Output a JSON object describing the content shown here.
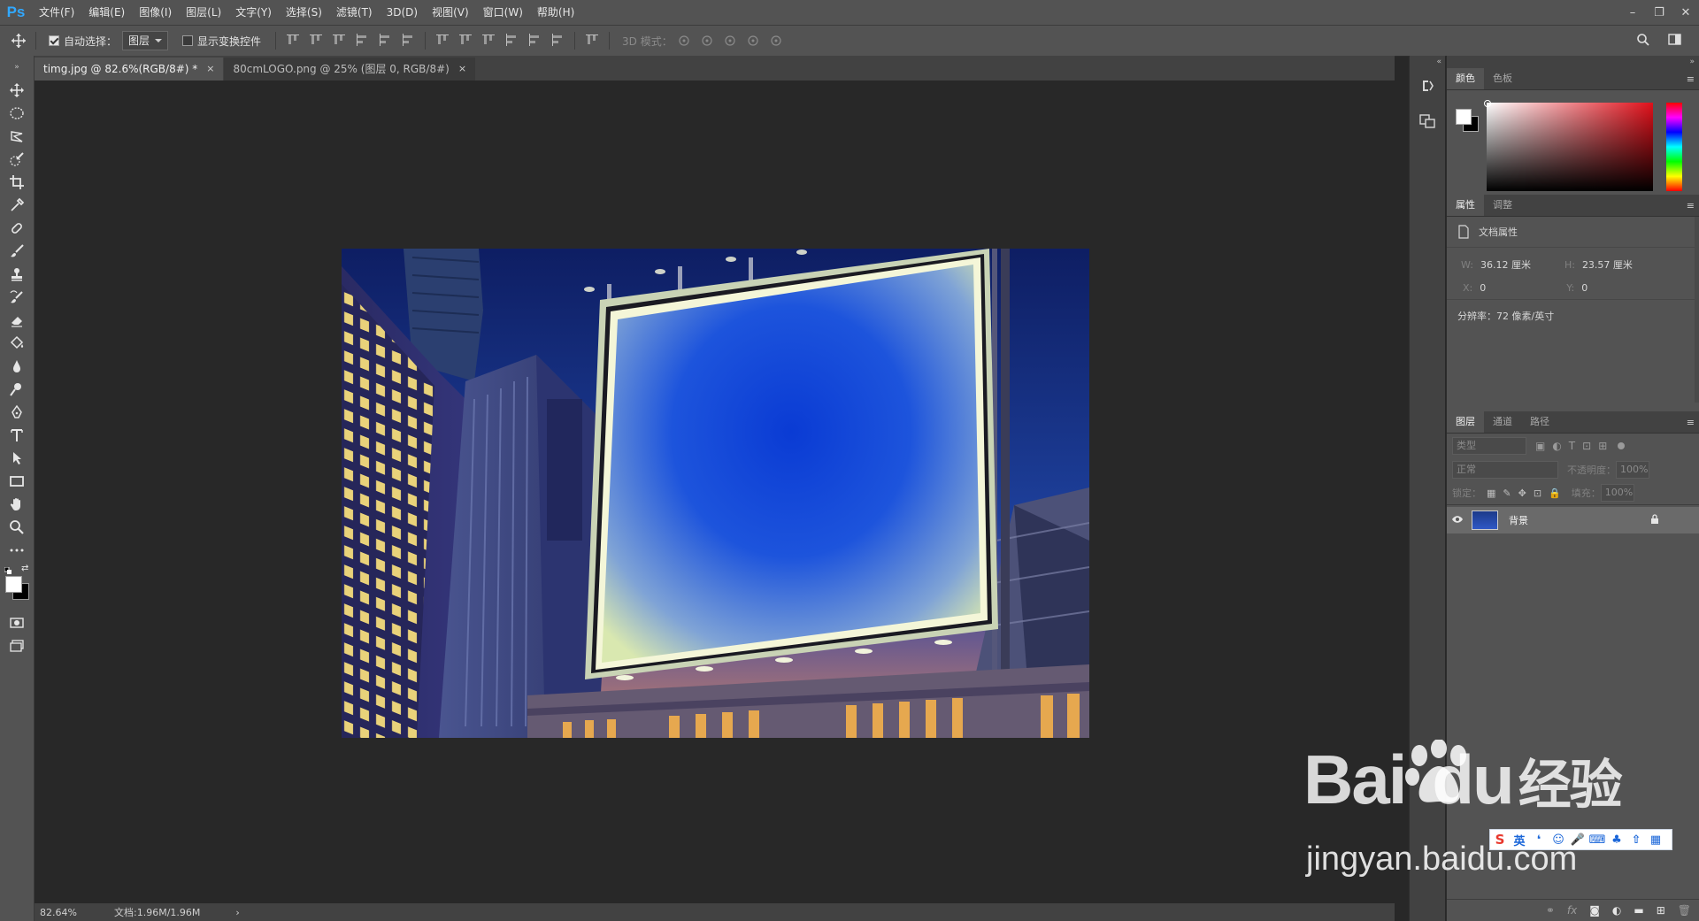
{
  "app": {
    "logo": "Ps"
  },
  "menu": [
    "文件(F)",
    "编辑(E)",
    "图像(I)",
    "图层(L)",
    "文字(Y)",
    "选择(S)",
    "滤镜(T)",
    "3D(D)",
    "视图(V)",
    "窗口(W)",
    "帮助(H)"
  ],
  "window_controls": {
    "minimize": "–",
    "restore": "❐",
    "close": "✕"
  },
  "options": {
    "auto_select_label": "自动选择：",
    "auto_select_checked": true,
    "auto_select_value": "图层",
    "show_transform_label": "显示变换控件",
    "show_transform_checked": false,
    "mode_3d_label": "3D 模式："
  },
  "tabs": [
    {
      "label": "timg.jpg @ 82.6%(RGB/8#) *",
      "active": true
    },
    {
      "label": "80cmLOGO.png @ 25% (图层 0, RGB/8#)",
      "active": false
    }
  ],
  "tab_close": "×",
  "status": {
    "zoom": "82.64%",
    "doc": "文档:1.96M/1.96M",
    "arrow": "›"
  },
  "color_panel": {
    "tabs": [
      "颜色",
      "色板"
    ],
    "hue_color": "#e0101a"
  },
  "properties_panel": {
    "tabs": [
      "属性",
      "调整"
    ],
    "title": "文档属性",
    "w_label": "W:",
    "w_value": "36.12 厘米",
    "h_label": "H:",
    "h_value": "23.57 厘米",
    "x_label": "X:",
    "x_value": "0",
    "y_label": "Y:",
    "y_value": "0",
    "resolution": "分辨率：72 像素/英寸"
  },
  "layers_panel": {
    "tabs": [
      "图层",
      "通道",
      "路径"
    ],
    "filter_placeholder": "类型",
    "blend_mode": "正常",
    "opacity_label": "不透明度：",
    "opacity_value": "100%",
    "lock_label": "锁定：",
    "fill_label": "填充：",
    "fill_value": "100%",
    "layers": [
      {
        "name": "背景",
        "visible": true,
        "locked": true
      }
    ]
  },
  "watermark": {
    "logo": "Bai",
    "logo_du": "du",
    "logo_cn": "经验",
    "url": "jingyan.baidu.com"
  },
  "ime": {
    "lang": "英"
  }
}
